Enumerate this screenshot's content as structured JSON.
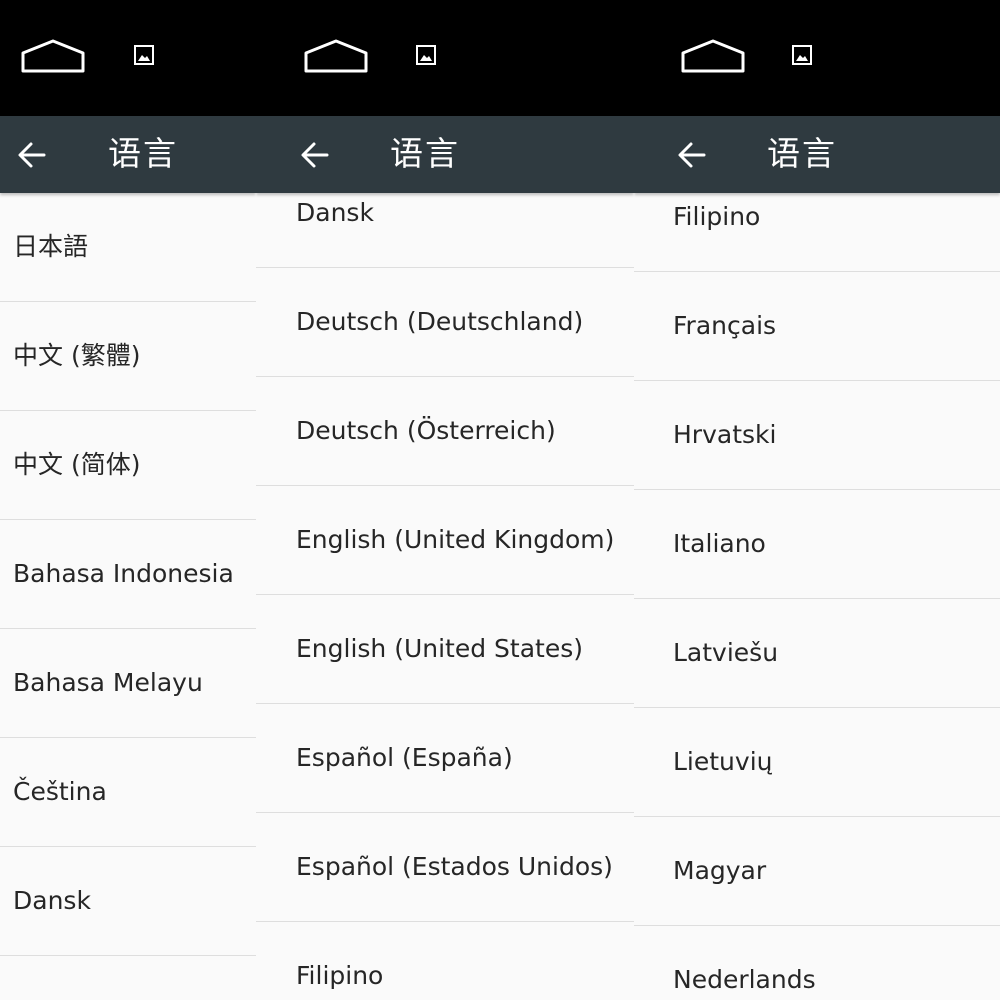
{
  "colors": {
    "status_bar": "#000000",
    "app_bar": "#2f3a40",
    "list_background": "#fafafa",
    "divider": "#dedede",
    "text_primary": "#262626",
    "app_bar_text": "#ffffff"
  },
  "icons": {
    "home": "home-outline-icon",
    "notification": "image-notification-icon",
    "back": "arrow-left-icon"
  },
  "screens": [
    {
      "title": "语言",
      "items": [
        "日本語",
        "中文 (繁體)",
        "中文 (简体)",
        "Bahasa Indonesia",
        "Bahasa Melayu",
        "Čeština",
        "Dansk"
      ]
    },
    {
      "title": "语言",
      "items": [
        "Dansk",
        "Deutsch (Deutschland)",
        "Deutsch (Österreich)",
        "English (United Kingdom)",
        "English (United States)",
        "Español (España)",
        "Español (Estados Unidos)",
        "Filipino"
      ]
    },
    {
      "title": "语言",
      "items": [
        "Filipino",
        "Français",
        "Hrvatski",
        "Italiano",
        "Latviešu",
        "Lietuvių",
        "Magyar",
        "Nederlands"
      ]
    }
  ]
}
